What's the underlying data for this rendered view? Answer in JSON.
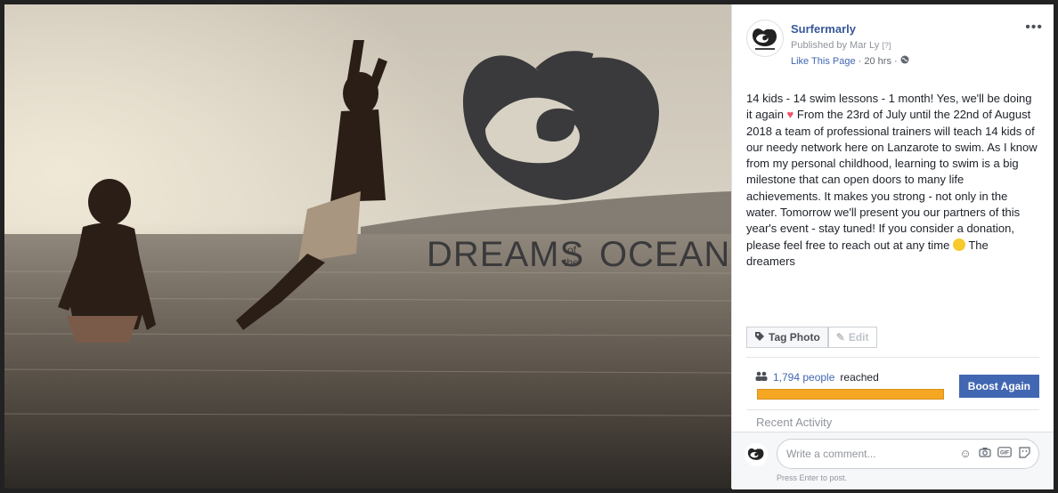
{
  "photo": {
    "logo_word_1": "DREAMS",
    "logo_word_of": "of",
    "logo_word_the": "the",
    "logo_word_2": "OCEAN"
  },
  "post": {
    "page_name": "Surfermarly",
    "published_by": "Published by Mar Ly",
    "published_help": "[?]",
    "like_page": "Like This Page",
    "time": "20 hrs",
    "more": "•••",
    "text_1": "14 kids - 14 swim lessons - 1 month! Yes, we'll be doing it again ",
    "text_2": " From the 23rd of July until the 22nd of August 2018 a team of professional trainers will teach 14 kids of our needy network here on Lanzarote to swim. As I know from my personal childhood, learning to swim is a big milestone that can open doors to many life achievements. It makes you strong - not only in the water. Tomorrow we'll present you our partners of this year's event - stay tuned! If you consider a donation, please feel free to reach out at any time ",
    "text_3": " The dreamers",
    "tag_photo": "Tag Photo",
    "edit": "Edit",
    "reached_count": "1,794 people",
    "reached_label": "reached",
    "reach_progress": 1.0,
    "boost_label": "Boost Again",
    "recent_activity": "Recent Activity",
    "comment_placeholder": "Write a comment...",
    "press_enter": "Press Enter to post.",
    "gif": "GIF"
  },
  "colors": {
    "link": "#4267b2",
    "page_name": "#385898",
    "progress": "#f5a623",
    "heart": "#f25268"
  }
}
